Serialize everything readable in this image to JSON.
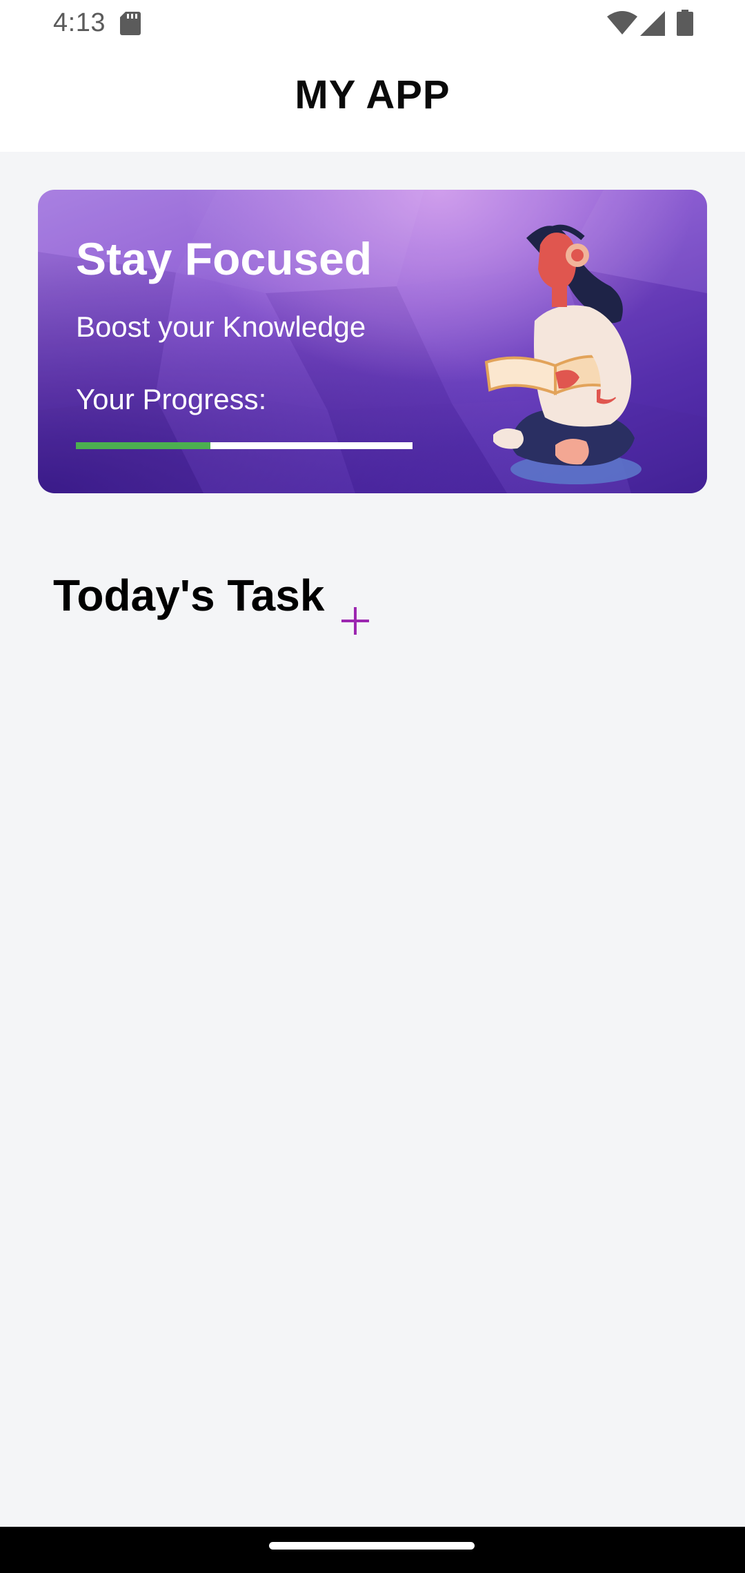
{
  "status_bar": {
    "time": "4:13",
    "icons": [
      "sd-card-icon",
      "wifi-icon",
      "cell-signal-icon",
      "battery-icon"
    ]
  },
  "app_bar": {
    "title": "MY APP"
  },
  "hero_card": {
    "title": "Stay Focused",
    "subtitle": "Boost your Knowledge",
    "progress_label": "Your Progress:",
    "progress_fraction": 0.4,
    "illustration": "person-reading-with-headphones"
  },
  "tasks": {
    "section_title": "Today's Task",
    "add_icon": "plus-icon"
  },
  "colors": {
    "accent": "#9c27b0",
    "progress": "#4caf50",
    "card_gradient": [
      "#a57ae0",
      "#48249e"
    ],
    "background": "#f4f5f7"
  }
}
